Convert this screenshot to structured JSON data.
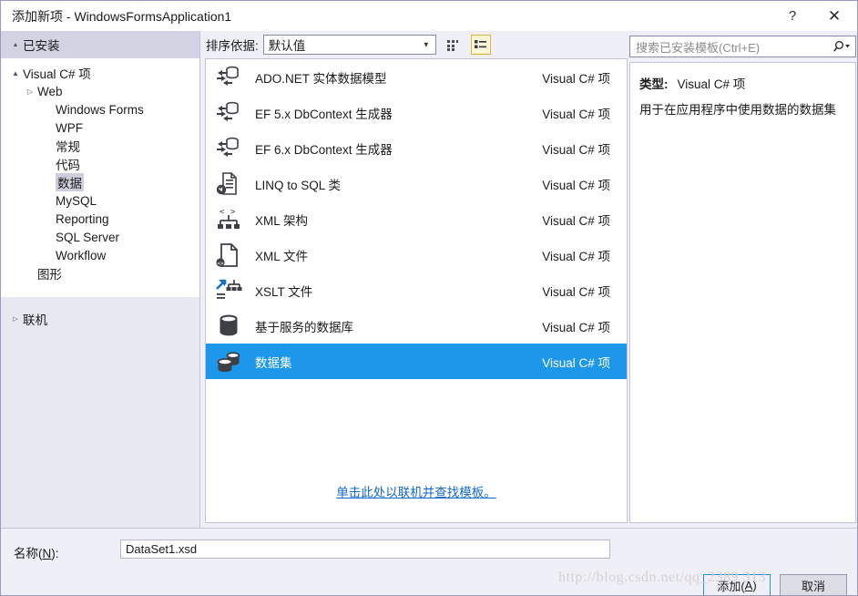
{
  "window": {
    "title": "添加新项 - WindowsFormsApplication1",
    "help_label": "?",
    "close_label": "✕"
  },
  "sidebar": {
    "installed_header": "已安装",
    "installed_expander": "▲",
    "tree": [
      {
        "label": "Visual C# 项",
        "level": 0,
        "expander": "▲",
        "selected": false
      },
      {
        "label": "Web",
        "level": 1,
        "expander": "▷",
        "selected": false
      },
      {
        "label": "Windows Forms",
        "level": 2,
        "expander": "",
        "selected": false
      },
      {
        "label": "WPF",
        "level": 2,
        "expander": "",
        "selected": false
      },
      {
        "label": "常规",
        "level": 2,
        "expander": "",
        "selected": false
      },
      {
        "label": "代码",
        "level": 2,
        "expander": "",
        "selected": false
      },
      {
        "label": "数据",
        "level": 2,
        "expander": "",
        "selected": true
      },
      {
        "label": "MySQL",
        "level": 2,
        "expander": "",
        "selected": false
      },
      {
        "label": "Reporting",
        "level": 2,
        "expander": "",
        "selected": false
      },
      {
        "label": "SQL Server",
        "level": 2,
        "expander": "",
        "selected": false
      },
      {
        "label": "Workflow",
        "level": 2,
        "expander": "",
        "selected": false
      },
      {
        "label": "图形",
        "level": 1,
        "expander": "",
        "selected": false
      }
    ],
    "online": {
      "label": "联机",
      "expander": "▷"
    }
  },
  "toolbar": {
    "sort_label": "排序依据:",
    "sort_value": "默认值",
    "sort_caret": "▼",
    "view_small_icons": "small-icons-view",
    "view_list": "list-view"
  },
  "templates": {
    "kind_column": "Visual C# 项",
    "items": [
      {
        "name": "ADO.NET 实体数据模型",
        "kind": "Visual C# 项",
        "icon": "entity-data-model-icon",
        "selected": false
      },
      {
        "name": "EF 5.x DbContext 生成器",
        "kind": "Visual C# 项",
        "icon": "entity-data-model-icon",
        "selected": false
      },
      {
        "name": "EF 6.x DbContext 生成器",
        "kind": "Visual C# 项",
        "icon": "entity-data-model-icon",
        "selected": false
      },
      {
        "name": "LINQ to SQL 类",
        "kind": "Visual C# 项",
        "icon": "linq-to-sql-icon",
        "selected": false
      },
      {
        "name": "XML 架构",
        "kind": "Visual C# 项",
        "icon": "xml-schema-icon",
        "selected": false
      },
      {
        "name": "XML 文件",
        "kind": "Visual C# 项",
        "icon": "xml-file-icon",
        "selected": false
      },
      {
        "name": "XSLT 文件",
        "kind": "Visual C# 项",
        "icon": "xslt-file-icon",
        "selected": false
      },
      {
        "name": "基于服务的数据库",
        "kind": "Visual C# 项",
        "icon": "database-icon",
        "selected": false
      },
      {
        "name": "数据集",
        "kind": "Visual C# 项",
        "icon": "dataset-icon",
        "selected": true
      }
    ],
    "online_link": "单击此处以联机并查找模板。"
  },
  "search": {
    "placeholder": "搜索已安装模板(Ctrl+E)",
    "value": ""
  },
  "details": {
    "type_label": "类型:",
    "type_value": "Visual C# 项",
    "description": "用于在应用程序中使用数据的数据集"
  },
  "footer": {
    "name_label_prefix": "名称(",
    "name_label_key": "N",
    "name_label_suffix": "):",
    "name_value": "DataSet1.xsd",
    "add_prefix": "添加(",
    "add_key": "A",
    "add_suffix": ")",
    "cancel_label": "取消"
  },
  "watermark": {
    "text": "http://blog.csdn.net/qq_2389 313"
  },
  "colors": {
    "selection_blue": "#1c97ea",
    "link_blue": "#1267cf",
    "panel_lavender": "#eff0f7",
    "sidebar_header": "#d3d4e3",
    "accent_yellow": "#e0b33a"
  }
}
